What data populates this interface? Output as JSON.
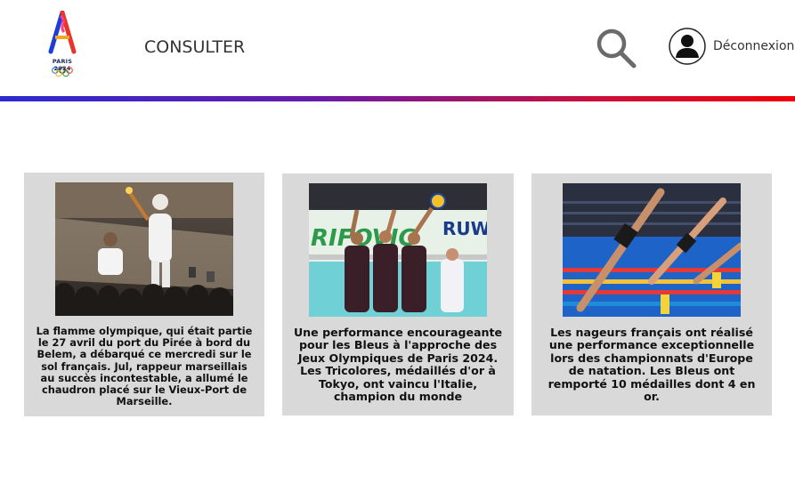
{
  "header": {
    "logo_text": "PARIS 2024",
    "nav_label": "CONSULTER",
    "search_icon": "search-icon",
    "user_icon": "user-icon",
    "logout_label": "Déconnexion"
  },
  "colors": {
    "divider_start": "#2a2bd0",
    "divider_end": "#f0000a",
    "card_bg": "#d9d9d9"
  },
  "cards": [
    {
      "image": "torch-relay-photo",
      "text": "La flamme olympique, qui était partie le 27 avril du port du Pirée à bord du Belem, a débarqué ce mercredi sur le sol français. Jul, rappeur marseillais au succès incontestable, a allumé le chaudron placé sur le Vieux-Port de Marseille."
    },
    {
      "image": "volleyball-block-photo",
      "text": "Une performance encourageante pour les Bleus à l'approche des Jeux Olympiques de Paris 2024. Les Tricolores, médaillés d'or à Tokyo, ont vaincu l'Italie, champion du monde"
    },
    {
      "image": "swimmers-diving-photo",
      "text": "Les nageurs français ont réalisé une performance exceptionnelle lors des championnats d'Europe de natation. Les Bleus ont remporté 10 médailles dont 4 en or."
    }
  ]
}
